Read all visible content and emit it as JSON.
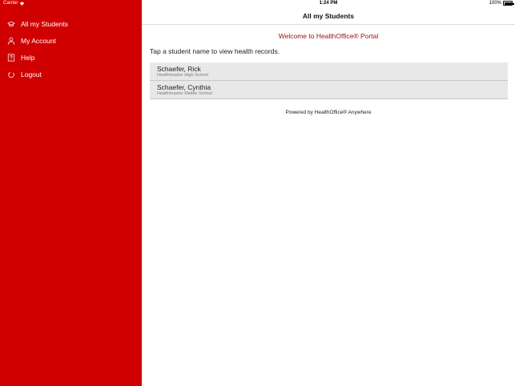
{
  "status_bar": {
    "carrier": "Carrier",
    "time": "1:24 PM",
    "battery": "100%"
  },
  "sidebar": {
    "items": [
      {
        "label": "All my Students",
        "icon": "graduation-cap-icon"
      },
      {
        "label": "My Account",
        "icon": "user-icon"
      },
      {
        "label": "Help",
        "icon": "help-icon"
      },
      {
        "label": "Logout",
        "icon": "logout-icon"
      }
    ]
  },
  "header": {
    "title": "All my Students"
  },
  "main": {
    "welcome": "Welcome to HealthOffice® Portal",
    "instructions": "Tap a student name to view health records.",
    "students": [
      {
        "name": "Schaefer, Rick",
        "school": "Healthmaster High School"
      },
      {
        "name": "Schaefer, Cynthia",
        "school": "Healthmaster Middle School"
      }
    ],
    "footer": "Powered by HealthOffice® Anywhere"
  },
  "colors": {
    "sidebar_bg": "#d10000",
    "welcome_text": "#9a1010"
  }
}
